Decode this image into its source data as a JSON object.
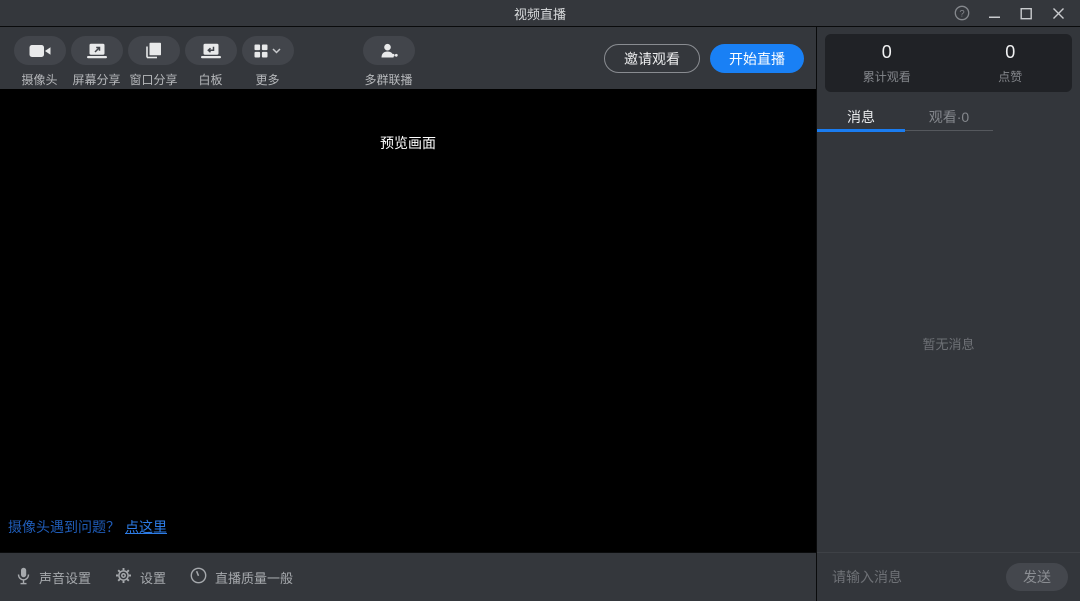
{
  "titlebar": {
    "title": "视频直播"
  },
  "toolbar": {
    "tools": [
      {
        "label": "摄像头",
        "icon": "camera-icon"
      },
      {
        "label": "屏幕分享",
        "icon": "screen-share-icon"
      },
      {
        "label": "窗口分享",
        "icon": "window-share-icon"
      },
      {
        "label": "白板",
        "icon": "whiteboard-icon"
      },
      {
        "label": "更多",
        "icon": "more-grid-icon"
      },
      {
        "label": "多群联播",
        "icon": "multi-group-icon"
      }
    ],
    "invite_button": "邀请观看",
    "start_button": "开始直播"
  },
  "preview": {
    "placeholder": "预览画面",
    "help_question": "摄像头遇到问题？",
    "help_link": "点这里"
  },
  "statusbar": {
    "sound_settings": "声音设置",
    "settings": "设置",
    "quality": "直播质量一般"
  },
  "panel": {
    "stats": [
      {
        "value": "0",
        "label": "累计观看"
      },
      {
        "value": "0",
        "label": "点赞"
      }
    ],
    "tabs": [
      {
        "label": "消息"
      },
      {
        "label": "观看·0"
      }
    ],
    "empty_message": "暂无消息",
    "input_placeholder": "请输入消息",
    "send_button": "发送"
  },
  "colors": {
    "accent_blue": "#1980f5",
    "tab_underline_blue": "#1a7cf0",
    "link_blue": "#2d7ce6",
    "window_bg": "#34373c",
    "panel_bg": "#33363b",
    "stats_card_bg": "#202226"
  }
}
